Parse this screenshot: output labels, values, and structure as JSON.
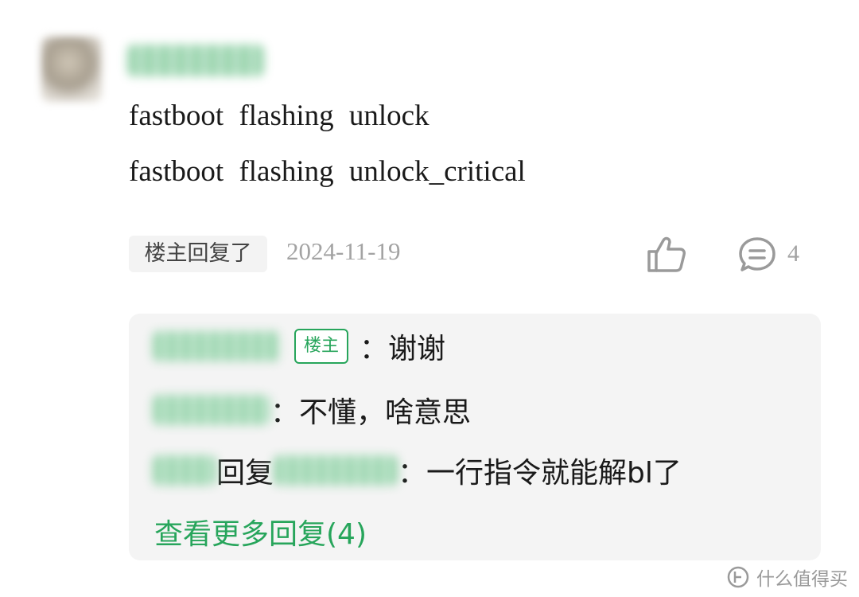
{
  "post": {
    "code_lines": [
      "fastboot flashing unlock",
      "fastboot flashing unlock_critical"
    ],
    "op_replied_badge": "楼主回复了",
    "date": "2024-11-19",
    "comment_count": "4"
  },
  "replies": {
    "row1": {
      "tag": "楼主",
      "text": "：谢谢"
    },
    "row2": {
      "text": "：不懂，啥意思"
    },
    "row3": {
      "mid": "回复",
      "text": "：一行指令就能解bl了"
    },
    "more_link": "查看更多回复(4)"
  },
  "icons": [
    "thumbs-up-icon",
    "comment-icon",
    "logo-icon"
  ],
  "colors": {
    "accent_green": "#27a55b",
    "muted_gray": "#a3a3a3",
    "reply_bg": "#f4f4f4"
  },
  "watermark": {
    "text": "什么值得买"
  }
}
